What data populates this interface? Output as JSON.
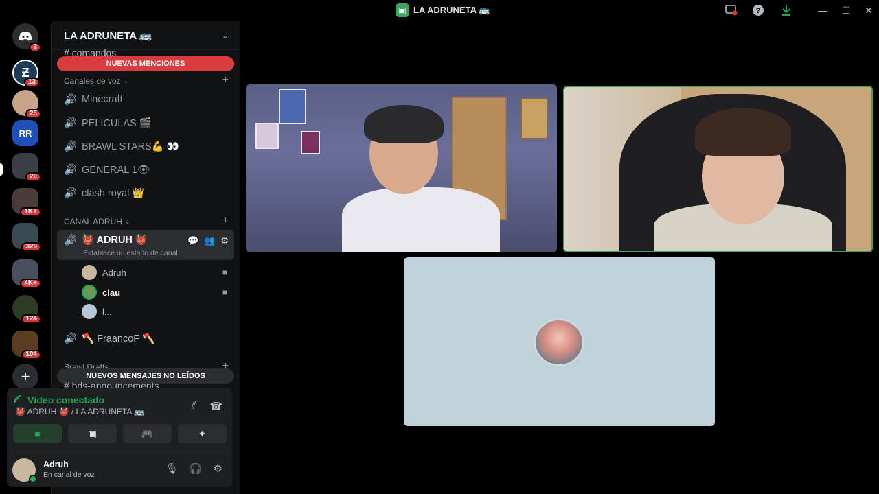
{
  "window": {
    "title": "LA ADRUNETA 🚌",
    "title_icon": "server-icon"
  },
  "rail": {
    "home_badge": "3",
    "servers": [
      {
        "name": "server-zeta",
        "badge": "13",
        "color": "#1e3c5a"
      },
      {
        "name": "server-avatar-2",
        "badge": "25",
        "color": "#c7a48a"
      },
      {
        "name": "server-rr-coaching",
        "label": "RR",
        "badge": "",
        "color": "#1f4fb8"
      },
      {
        "name": "server-group-4",
        "badge": "20",
        "color": "#3a3f46"
      },
      {
        "name": "server-group-5",
        "badge": "1K+",
        "color": "#4b3c3c"
      },
      {
        "name": "server-group-6",
        "badge": "329",
        "color": "#3a4a52"
      },
      {
        "name": "server-group-7",
        "badge": "4K+",
        "color": "#4a4f60"
      },
      {
        "name": "server-8",
        "badge": "124",
        "color": "#2b3b24"
      },
      {
        "name": "server-group-9",
        "badge": "104",
        "color": "#5a3c20"
      }
    ]
  },
  "sidebar": {
    "guild_name": "LA ADRUNETA 🚌",
    "partial_channel": "# comandos",
    "new_mentions": "NUEVAS MENCIONES",
    "voice_category": "Canales de voz",
    "voice_channels": [
      {
        "name": "Minecraft"
      },
      {
        "name": "PELICULAS 🎬"
      },
      {
        "name": "BRAWL STARS💪 👀"
      },
      {
        "name": "GENERAL 1👁"
      },
      {
        "name": "clash royal 👑"
      }
    ],
    "adruh_category": "CANAL ADRUH",
    "active_channel": {
      "name": "👹 ADRUH 👹",
      "status_placeholder": "Establece un estado de canal"
    },
    "members": [
      {
        "name": "Adruh",
        "camera": true,
        "color": "#c9b8a0"
      },
      {
        "name": "clau",
        "camera": true,
        "color": "#6a9a5a"
      },
      {
        "name": "l...",
        "camera": false,
        "color": "#b7c7d6"
      }
    ],
    "second_channel": "🪓 FraancoF 🪓",
    "brawl_category": "Brawl Drafts",
    "partial_bottom": "# bds-announcements",
    "new_unread": "NUEVOS MENSAJES NO LEÍDOS"
  },
  "voice_panel": {
    "status": "Vídeo conectado",
    "location": "👹 ADRUH 👹  / LA ADRUNETA 🚌",
    "buttons": [
      "camera-icon",
      "screen-share-icon",
      "activity-icon",
      "soundboard-icon"
    ]
  },
  "user": {
    "name": "Adruh",
    "status": "En canal de voz"
  },
  "stage": {
    "tiles": [
      {
        "name": "video-tile-adruh",
        "speaking": false
      },
      {
        "name": "video-tile-clau",
        "speaking": true
      },
      {
        "name": "avatar-tile-third",
        "speaking": false
      }
    ]
  },
  "colors": {
    "accent_green": "#23a55a",
    "mention_red": "#d83c3e",
    "sidebar_bg": "#111214"
  }
}
